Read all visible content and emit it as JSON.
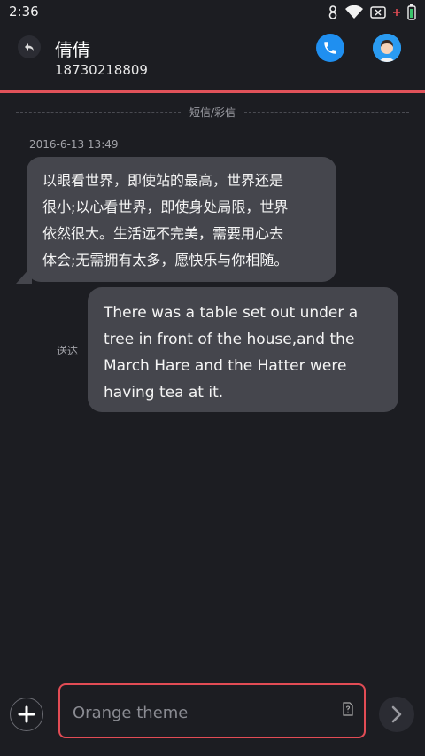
{
  "status_bar": {
    "time": "2:36"
  },
  "header": {
    "contact_name": "倩倩",
    "contact_number": "18730218809"
  },
  "conversation": {
    "divider_label": "短信/彩信",
    "timestamp": "2016-6-13 13:49",
    "incoming": {
      "lines": [
        "以眼看世界，即使站的最高，世界还是",
        "很小;以心看世界，即使身处局限，世界",
        "依然很大。生活远不完美，需要用心去",
        "体会;无需拥有太多，愿快乐与你相随。"
      ]
    },
    "outgoing": {
      "lines": [
        "There was a table set out under a",
        "tree in front of the house,and the",
        "March Hare and the Hatter were",
        "having tea at it."
      ],
      "status": "送达"
    }
  },
  "composer": {
    "placeholder": "Orange theme"
  },
  "colors": {
    "accent": "#e24c55",
    "call": "#1f8ff0",
    "bubble": "#45464d",
    "background": "#1c1d22"
  }
}
